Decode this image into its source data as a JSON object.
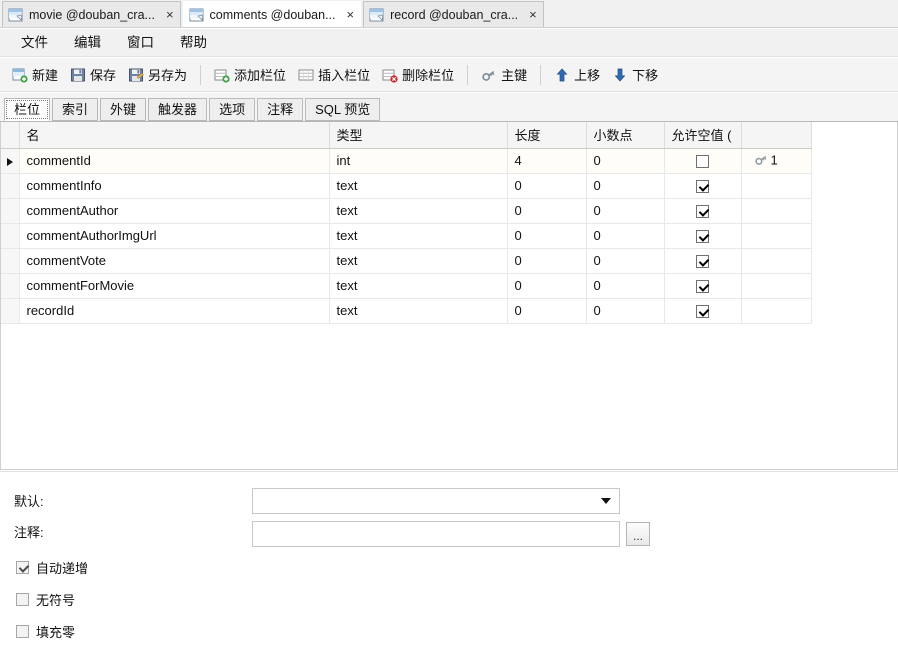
{
  "window": {
    "doc_tabs": [
      {
        "label": "movie @douban_cra...",
        "close": "×",
        "icon": "table-icon",
        "active": false
      },
      {
        "label": "comments @douban...",
        "close": "×",
        "icon": "table-icon",
        "active": true
      },
      {
        "label": "record @douban_cra...",
        "close": "×",
        "icon": "table-icon",
        "active": false
      }
    ]
  },
  "menubar": {
    "items": [
      {
        "label": "文件"
      },
      {
        "label": "编辑"
      },
      {
        "label": "窗口"
      },
      {
        "label": "帮助"
      }
    ]
  },
  "toolbar": {
    "groups": [
      [
        {
          "label": "新建",
          "icon": "new-table-icon"
        },
        {
          "label": "保存",
          "icon": "save-icon"
        },
        {
          "label": "另存为",
          "icon": "save-as-icon"
        }
      ],
      [
        {
          "label": "添加栏位",
          "icon": "add-field-icon"
        },
        {
          "label": "插入栏位",
          "icon": "insert-field-icon"
        },
        {
          "label": "删除栏位",
          "icon": "delete-field-icon"
        }
      ],
      [
        {
          "label": "主键",
          "icon": "primary-key-icon"
        }
      ],
      [
        {
          "label": "上移",
          "icon": "move-up-icon"
        },
        {
          "label": "下移",
          "icon": "move-down-icon"
        }
      ]
    ]
  },
  "inner_tabs": [
    {
      "label": "栏位",
      "active": true
    },
    {
      "label": "索引",
      "active": false
    },
    {
      "label": "外键",
      "active": false
    },
    {
      "label": "触发器",
      "active": false
    },
    {
      "label": "选项",
      "active": false
    },
    {
      "label": "注释",
      "active": false
    },
    {
      "label": "SQL 预览",
      "active": false
    }
  ],
  "grid": {
    "columns": [
      {
        "key": "name",
        "label": "名"
      },
      {
        "key": "type",
        "label": "类型"
      },
      {
        "key": "length",
        "label": "长度"
      },
      {
        "key": "decimals",
        "label": "小数点"
      },
      {
        "key": "nullable",
        "label": "允许空值 ("
      },
      {
        "key": "key",
        "label": ""
      }
    ],
    "rows": [
      {
        "selected": true,
        "name": "commentId",
        "type": "int",
        "length": "4",
        "decimals": "0",
        "nullable": false,
        "key": "1"
      },
      {
        "selected": false,
        "name": "commentInfo",
        "type": "text",
        "length": "0",
        "decimals": "0",
        "nullable": true,
        "key": ""
      },
      {
        "selected": false,
        "name": "commentAuthor",
        "type": "text",
        "length": "0",
        "decimals": "0",
        "nullable": true,
        "key": ""
      },
      {
        "selected": false,
        "name": "commentAuthorImgUrl",
        "type": "text",
        "length": "0",
        "decimals": "0",
        "nullable": true,
        "key": ""
      },
      {
        "selected": false,
        "name": "commentVote",
        "type": "text",
        "length": "0",
        "decimals": "0",
        "nullable": true,
        "key": ""
      },
      {
        "selected": false,
        "name": "commentForMovie",
        "type": "text",
        "length": "0",
        "decimals": "0",
        "nullable": true,
        "key": ""
      },
      {
        "selected": false,
        "name": "recordId",
        "type": "text",
        "length": "0",
        "decimals": "0",
        "nullable": true,
        "key": ""
      }
    ]
  },
  "properties": {
    "default_label": "默认:",
    "default_value": "",
    "comment_label": "注释:",
    "comment_value": "",
    "ellipsis_button": "...",
    "checkboxes": [
      {
        "label": "自动递增",
        "checked": true
      },
      {
        "label": "无符号",
        "checked": false
      },
      {
        "label": "填充零",
        "checked": false
      }
    ]
  },
  "colors": {
    "toolbar_bg": "#f4f4f4",
    "tab_active_bg": "#ffffff",
    "grid_header_bg": "#f5f5f5",
    "selected_row_bg": "#fffdf7",
    "accent_blue": "#3a6ea5"
  }
}
